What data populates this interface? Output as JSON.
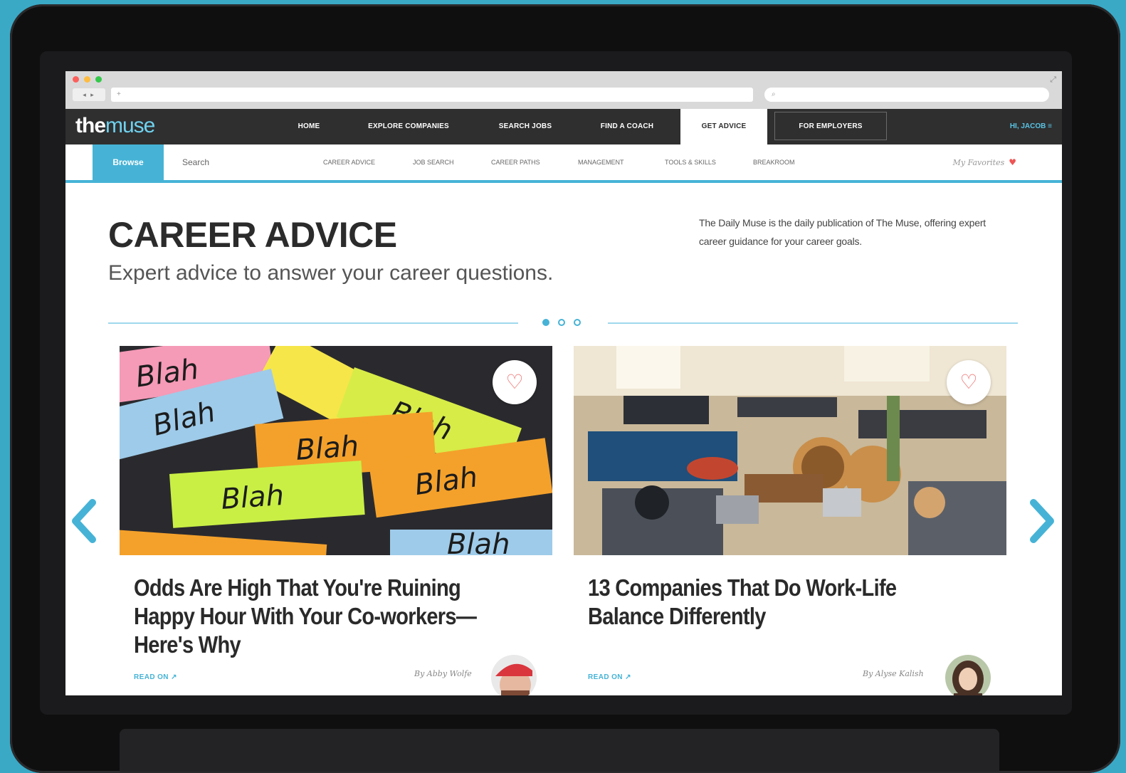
{
  "browser": {
    "nav_buttons": "◂ ▸",
    "url_text": "+",
    "search_placeholder": "⌕",
    "expand_icon": "⤢"
  },
  "site": {
    "logo_part1": "the",
    "logo_part2": "muse",
    "nav": [
      {
        "label": "HOME"
      },
      {
        "label": "EXPLORE COMPANIES"
      },
      {
        "label": "SEARCH JOBS"
      },
      {
        "label": "FIND A COACH"
      },
      {
        "label": "GET ADVICE"
      },
      {
        "label": "FOR EMPLOYERS"
      }
    ],
    "user_greeting": "HI, JACOB ≡"
  },
  "subnav": {
    "browse": "Browse",
    "search": "Search",
    "items": [
      "CAREER ADVICE",
      "JOB SEARCH",
      "CAREER PATHS",
      "MANAGEMENT",
      "TOOLS & SKILLS",
      "BREAKROOM"
    ],
    "favorites": "My Favorites",
    "favorites_icon": "♥"
  },
  "hero": {
    "title": "CAREER ADVICE",
    "subtitle": "Expert advice to answer your career questions.",
    "blurb": "The Daily Muse is the daily publication of The Muse, offering expert career guidance for your career goals."
  },
  "carousel": {
    "active_page": 1,
    "page_count": 3
  },
  "cards": [
    {
      "title": "Odds Are High That You're Ruining Happy Hour With Your Co-workers—Here's Why",
      "read_on": "READ ON ↗",
      "byline": "By Abby Wolfe",
      "favorite_icon": "♡",
      "image_words": [
        "Blah",
        "Blah",
        "Blah",
        "Blah",
        "Blah",
        "Blah",
        "Blah"
      ]
    },
    {
      "title": "13 Companies That Do Work-Life Balance Differently",
      "read_on": "READ ON ↗",
      "byline": "By Alyse Kalish",
      "favorite_icon": "♡"
    }
  ],
  "colors": {
    "background": "#3aa9c6",
    "accent": "#46b3d6",
    "nav_dark": "#2f2f30",
    "heart": "#ee6b6b"
  }
}
